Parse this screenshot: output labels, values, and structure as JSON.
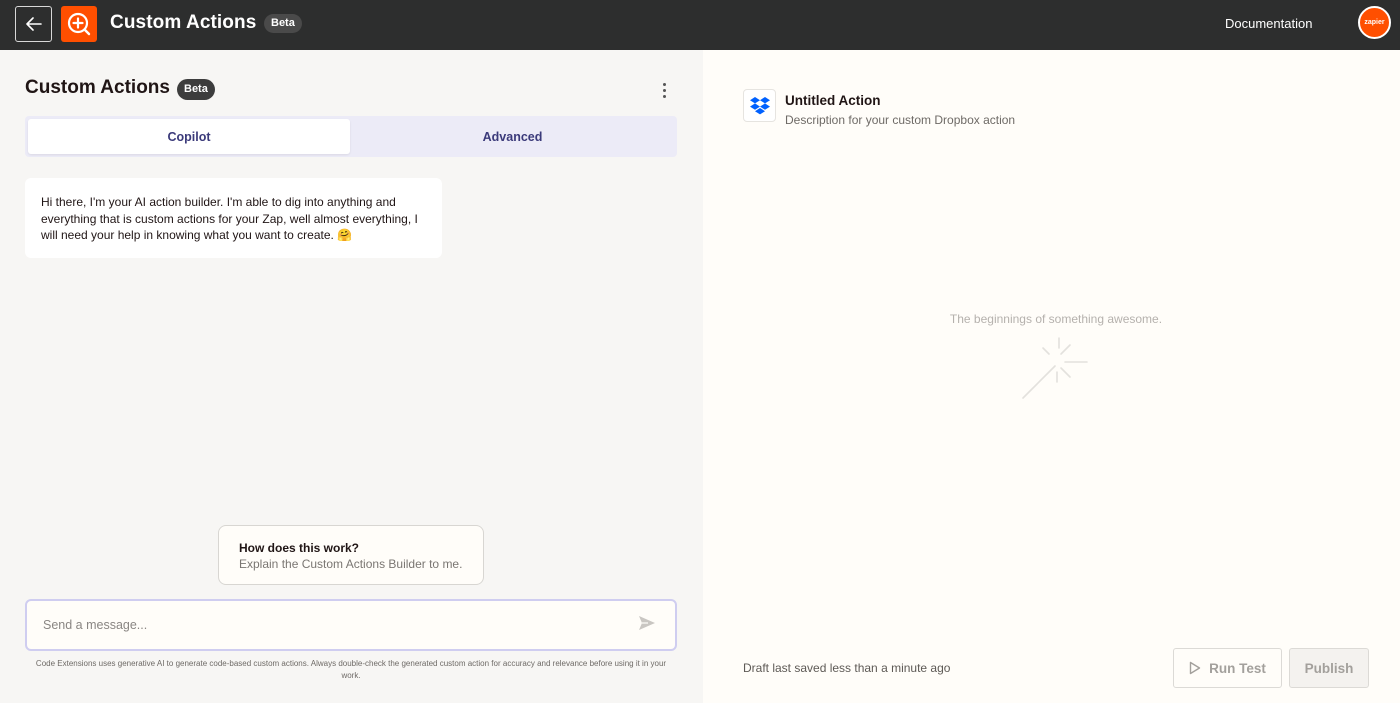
{
  "topbar": {
    "back_icon": "arrow-left-icon",
    "app_icon": "custom-actions-plus-icon",
    "title": "Custom Actions",
    "badge": "Beta",
    "docs_link": "Documentation",
    "avatar_text": "zapier"
  },
  "left_panel": {
    "title": "Custom Actions",
    "badge": "Beta",
    "tabs": [
      {
        "label": "Copilot",
        "active": true
      },
      {
        "label": "Advanced",
        "active": false
      }
    ],
    "bot_message": "Hi there, I'm your AI action builder. I'm able to dig into anything and everything that is custom actions for your Zap, well almost everything, I will need your help in knowing what you want to create. 🤗",
    "suggestion": {
      "title": "How does this work?",
      "subtitle": "Explain the Custom Actions Builder to me."
    },
    "input": {
      "placeholder": "Send a message...",
      "value": ""
    },
    "disclaimer": "Code Extensions uses generative AI to generate code-based custom actions. Always double-check the generated custom action for accuracy and relevance before using it in your work."
  },
  "right_panel": {
    "app_icon": "dropbox-icon",
    "action_title": "Untitled Action",
    "action_description": "Description for your custom Dropbox action",
    "empty_state": "The beginnings of something awesome.",
    "draft_status": "Draft last saved less than a minute ago",
    "run_test_label": "Run Test",
    "publish_label": "Publish"
  },
  "colors": {
    "topbar_bg": "#2d2e2e",
    "brand_orange": "#ff4f00",
    "left_bg": "#f7f6f4",
    "right_bg": "#fffdf9",
    "tab_text": "#3b3a7a",
    "dropbox_blue": "#0061ff"
  }
}
